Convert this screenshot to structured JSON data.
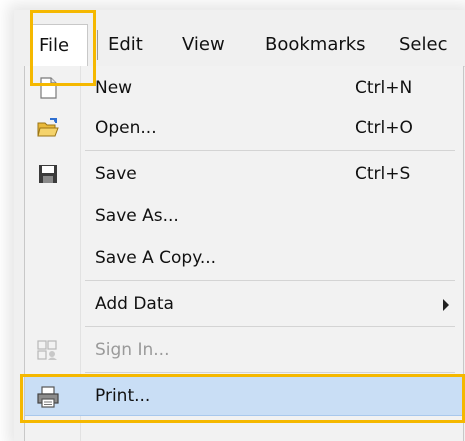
{
  "menubar": {
    "items": [
      {
        "label": "File"
      },
      {
        "label": "Edit"
      },
      {
        "label": "View"
      },
      {
        "label": "Bookmarks"
      },
      {
        "label": "Selec"
      }
    ]
  },
  "file_menu": {
    "items": [
      {
        "label": "New",
        "shortcut": "Ctrl+N",
        "icon": "new-document-icon",
        "enabled": true
      },
      {
        "label": "Open...",
        "shortcut": "Ctrl+O",
        "icon": "open-folder-icon",
        "enabled": true
      },
      {
        "label": "Save",
        "shortcut": "Ctrl+S",
        "icon": "floppy-disk-icon",
        "enabled": true
      },
      {
        "label": "Save As...",
        "shortcut": "",
        "icon": "",
        "enabled": true
      },
      {
        "label": "Save A Copy...",
        "shortcut": "",
        "icon": "",
        "enabled": true
      },
      {
        "label": "Add Data",
        "shortcut": "",
        "icon": "",
        "enabled": true,
        "has_submenu": true
      },
      {
        "label": "Sign In...",
        "shortcut": "",
        "icon": "sign-in-icon",
        "enabled": false
      },
      {
        "label": "Print...",
        "shortcut": "",
        "icon": "printer-icon",
        "enabled": true,
        "highlighted": true
      }
    ]
  },
  "colors": {
    "highlight_bg": "#c9def5",
    "callout": "#f5b800",
    "menu_bg": "#f2f2f2",
    "disabled_text": "#9a9a9a"
  }
}
